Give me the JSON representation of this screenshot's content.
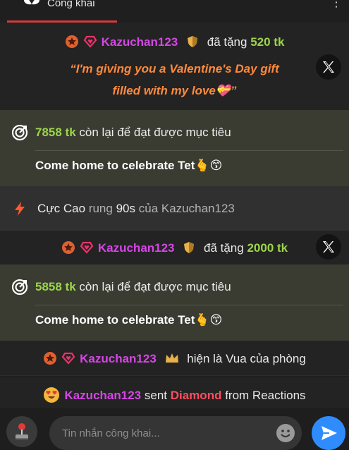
{
  "header": {
    "tab_label": "Công khai"
  },
  "messages": {
    "gift1": {
      "user": "Kazuchan123",
      "action": "đã tặng",
      "amount": "520 tk",
      "quote_line1": "“I'm giving you a Valentine's Day gift",
      "quote_line2": "filled with my love💝”"
    },
    "goal1": {
      "amount": "7858 tk",
      "text": "còn lại để đạt được mục tiêu",
      "title": "Come home to celebrate Tet🫰😙"
    },
    "system": {
      "level": "Cực Cao",
      "action": "rung",
      "duration": "90s",
      "of": "của",
      "user": "Kazuchan123"
    },
    "gift2": {
      "user": "Kazuchan123",
      "action": "đã tặng",
      "amount": "2000 tk"
    },
    "goal2": {
      "amount": "5858 tk",
      "text": "còn lại để đạt được mục tiêu",
      "title": "Come home to celebrate Tet🫰😙"
    },
    "king": {
      "user": "Kazuchan123",
      "text": "hiện là Vua của phòng"
    },
    "reaction": {
      "user": "Kazuchan123",
      "sent": "sent",
      "item": "Diamond",
      "from": "from Reactions"
    }
  },
  "composer": {
    "placeholder": "Tin nhắn công khai..."
  },
  "colors": {
    "accent": "#d33a3a",
    "user": "#d646e6",
    "amount": "#9cd54a",
    "send": "#2f8cff"
  }
}
